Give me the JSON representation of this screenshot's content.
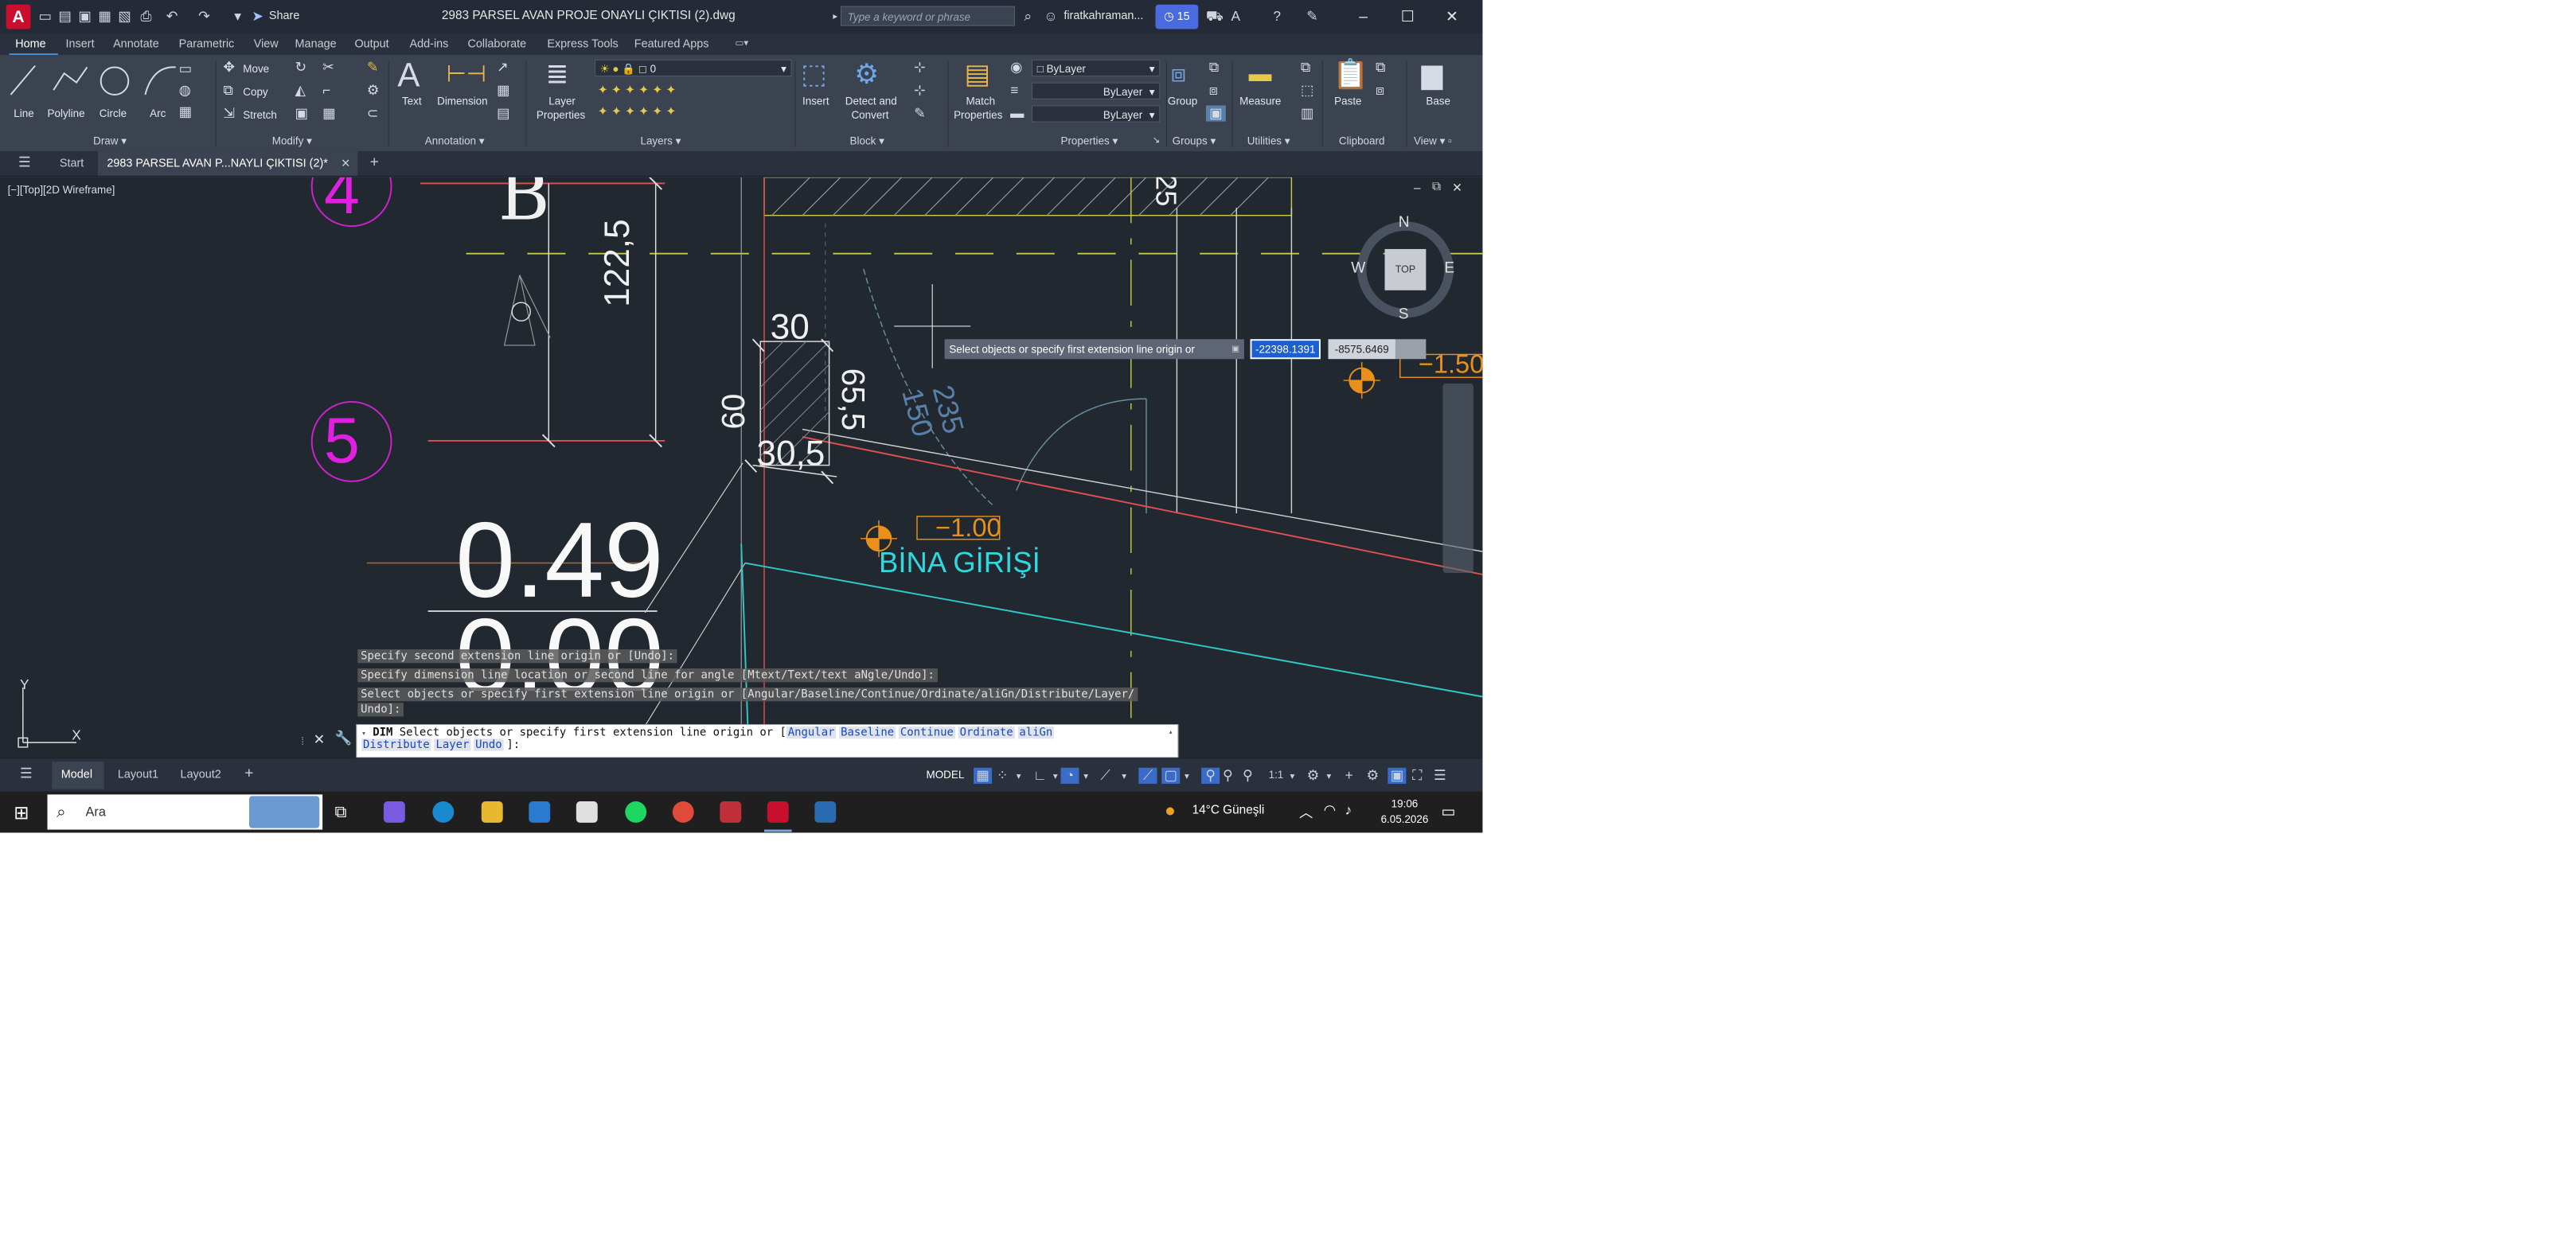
{
  "titlebar": {
    "title": "2983 PARSEL AVAN PROJE ONAYLI ÇIKTISI (2).dwg",
    "share_label": "Share",
    "search_placeholder": "Type a keyword or phrase",
    "user": "firatkahraman...",
    "badge_count": "15",
    "app_letter": "A"
  },
  "ribbon_tabs": [
    "Home",
    "Insert",
    "Annotate",
    "Parametric",
    "View",
    "Manage",
    "Output",
    "Add-ins",
    "Collaborate",
    "Express Tools",
    "Featured Apps"
  ],
  "ribbon": {
    "draw": {
      "title": "Draw",
      "line": "Line",
      "polyline": "Polyline",
      "circle": "Circle",
      "arc": "Arc"
    },
    "modify": {
      "title": "Modify",
      "move": "Move",
      "copy": "Copy",
      "stretch": "Stretch"
    },
    "annotation": {
      "title": "Annotation",
      "text": "Text",
      "dimension": "Dimension"
    },
    "layers": {
      "title": "Layers",
      "layer_properties_1": "Layer",
      "layer_properties_2": "Properties",
      "current_layer": "0"
    },
    "block": {
      "title": "Block",
      "insert": "Insert",
      "detect_1": "Detect and",
      "detect_2": "Convert"
    },
    "properties": {
      "title": "Properties",
      "match_1": "Match",
      "match_2": "Properties",
      "color": "ByLayer",
      "linetype": "ByLayer",
      "lineweight": "ByLayer"
    },
    "groups": {
      "title": "Groups",
      "group": "Group"
    },
    "utilities": {
      "title": "Utilities",
      "measure": "Measure"
    },
    "clipboard": {
      "title": "Clipboard",
      "paste": "Paste"
    },
    "view": {
      "title": "View",
      "base": "Base"
    }
  },
  "doc_tabs": {
    "start": "Start",
    "active": "2983 PARSEL AVAN P...NAYLI ÇIKTISI (2)*"
  },
  "viewport_label": "[−][Top][2D Wireframe]",
  "viewcube": {
    "n": "N",
    "s": "S",
    "e": "E",
    "w": "W",
    "top": "TOP"
  },
  "drawing_text": {
    "b_label": "B",
    "num4": "4",
    "num5": "5",
    "dim_122_5": "122,5",
    "dim_30": "30",
    "dim_60": "60",
    "dim_65_5": "65,5",
    "dim_30_5": "30,5",
    "dim_235": "235",
    "dim_150": "150",
    "big_049": "0.49",
    "big_000": "0.00",
    "level_100": "−1.00",
    "level_150": "−1.50",
    "bina_girisi": "BİNA GİRİŞİ",
    "dim_25": "25"
  },
  "tooltip": {
    "prompt": "Select objects or specify first extension line origin or",
    "x_value": "-22398.1391",
    "y_value": "-8575.6469"
  },
  "ucs": {
    "x": "X",
    "y": "Y"
  },
  "command_history": [
    "Specify second extension line origin or [Undo]:",
    "Specify dimension line location or second line for angle [Mtext/Text/text aNgle/Undo]:",
    "Select objects or specify first extension line origin or [Angular/Baseline/Continue/Ordinate/aliGn/Distribute/Layer/",
    "Undo]:"
  ],
  "command_line": {
    "command": "DIM",
    "prompt": "Select objects or specify first extension line origin or [",
    "options": [
      "Angular",
      "Baseline",
      "Continue",
      "Ordinate",
      "aliGn",
      "Distribute",
      "Layer",
      "Undo"
    ],
    "suffix": "]:"
  },
  "status": {
    "tabs": [
      "Model",
      "Layout1",
      "Layout2"
    ],
    "model_label": "MODEL",
    "scale": "1:1"
  },
  "taskbar": {
    "search": "Ara",
    "weather": "14°C Güneşli",
    "time": "19:06",
    "date": "6.05.2026"
  }
}
